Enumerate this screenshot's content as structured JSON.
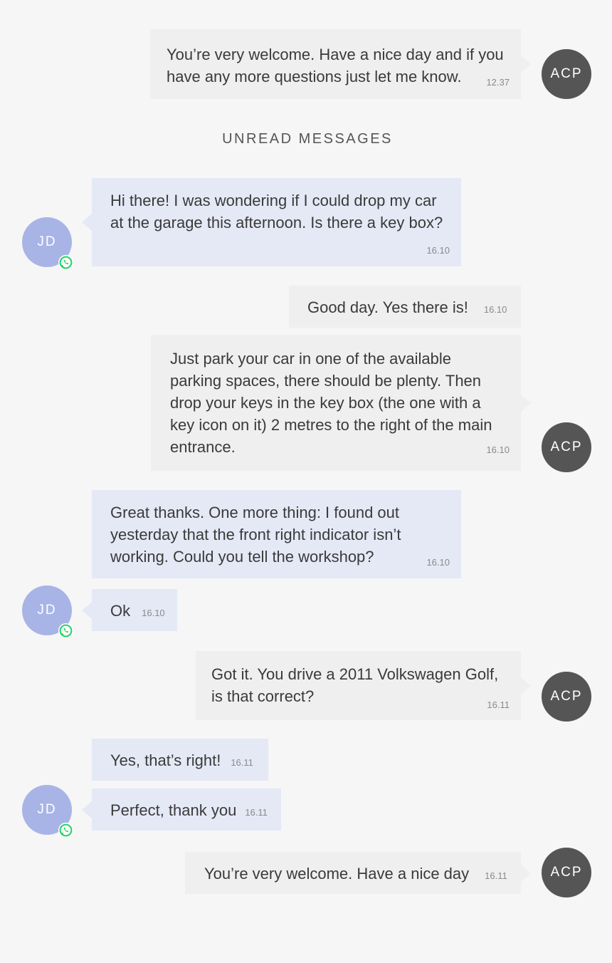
{
  "divider": {
    "label": "UNREAD MESSAGES"
  },
  "avatars": {
    "agent": "ACP",
    "customer": "JD"
  },
  "messages": [
    {
      "text": "You’re very welcome. Have a nice day and if you have any more questions just let me know.",
      "time": "12.37"
    },
    {
      "text": "Hi there! I was wondering if I could drop my car at the garage this afternoon. Is there a key box?",
      "time": "16.10"
    },
    {
      "text": "Good day. Yes there is!",
      "time": "16.10"
    },
    {
      "text": "Just park your car in one of the available parking spaces, there should be plenty. Then drop your keys in the key box (the one with a key icon on it) 2 metres to the right of the main entrance.",
      "time": "16.10"
    },
    {
      "text": "Great thanks. One more thing: I found out yesterday that the front right indicator isn’t working. Could you tell the workshop?",
      "time": "16.10"
    },
    {
      "text": "Ok",
      "time": "16.10"
    },
    {
      "text": "Got it. You drive a 2011 Volkswagen Golf, is that correct?",
      "time": "16.11"
    },
    {
      "text": "Yes, that’s right!",
      "time": "16.11"
    },
    {
      "text": "Perfect, thank you",
      "time": "16.11"
    },
    {
      "text": "You’re very welcome. Have a nice day",
      "time": "16.11"
    }
  ]
}
